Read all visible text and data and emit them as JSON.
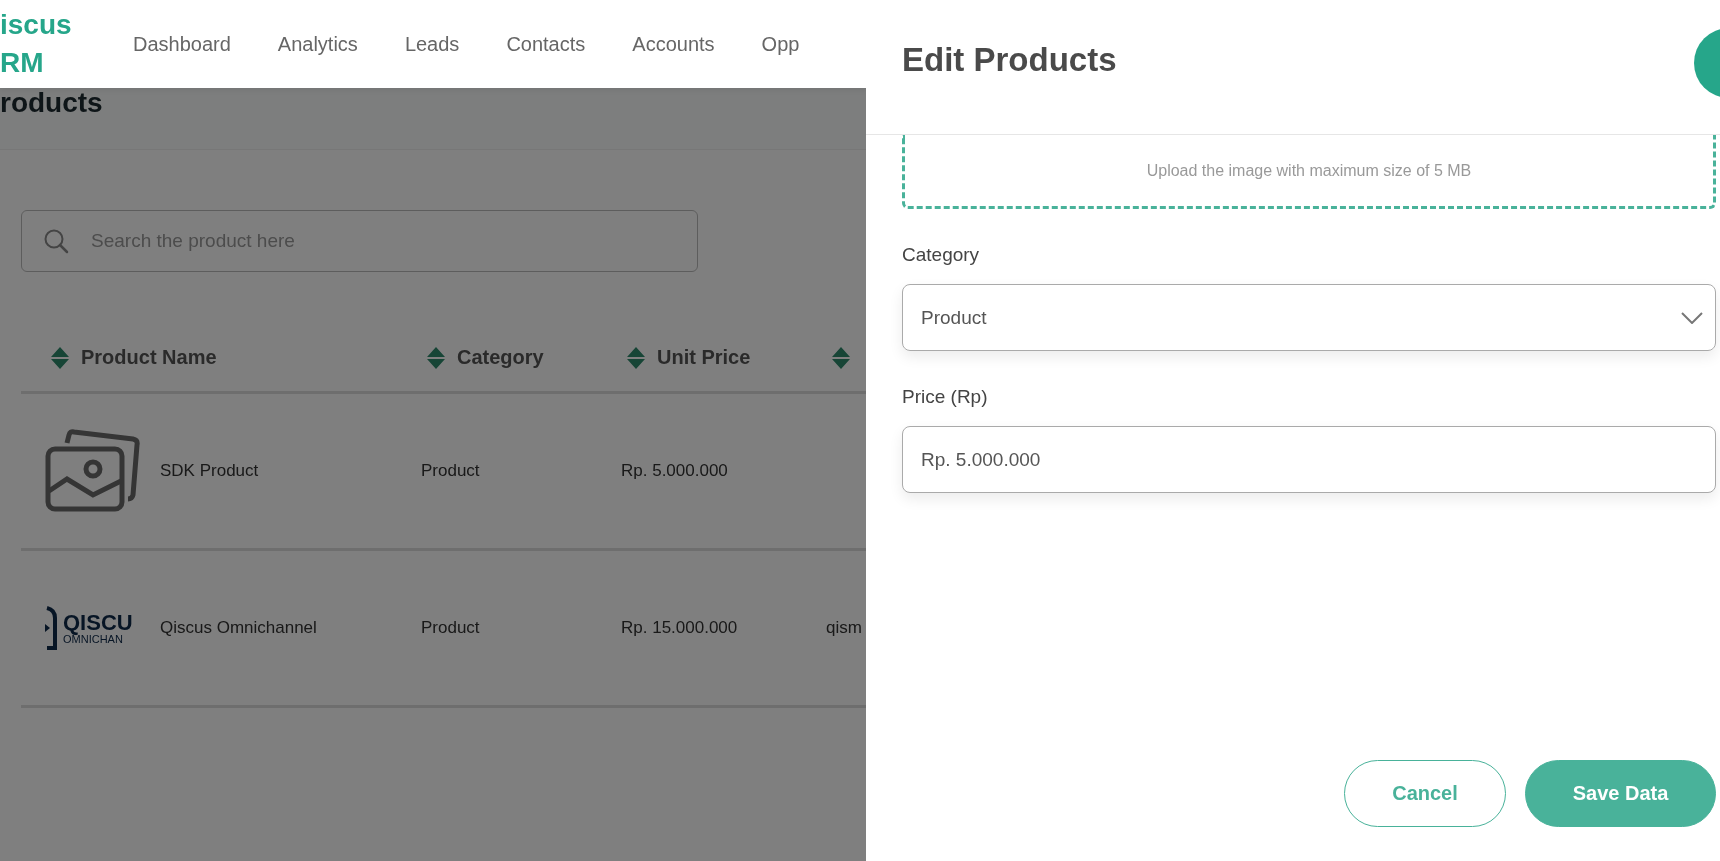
{
  "brand": {
    "lines": [
      "iscus",
      "RM"
    ]
  },
  "nav": [
    {
      "label": "Dashboard"
    },
    {
      "label": "Analytics"
    },
    {
      "label": "Leads"
    },
    {
      "label": "Contacts"
    },
    {
      "label": "Accounts"
    },
    {
      "label": "Opp"
    }
  ],
  "page_title": "roducts",
  "search": {
    "placeholder": "Search the product here"
  },
  "table": {
    "columns": [
      "Product Name",
      "Category",
      "Unit Price"
    ],
    "rows": [
      {
        "thumbnail": {
          "kind": "placeholder"
        },
        "name": "SDK Product",
        "category": "Product",
        "unit_price": "Rp. 5.000.000"
      },
      {
        "thumbnail": {
          "kind": "logo",
          "lines": [
            "QISCU",
            "OMNICHAN"
          ]
        },
        "name": "Qiscus Omnichannel",
        "category": "Product",
        "unit_price": "Rp. 15.000.000",
        "column_4": "qism"
      }
    ]
  },
  "drawer": {
    "title": "Edit Products",
    "upload_hint": "Upload the image with maximum size of 5 MB",
    "fields": [
      {
        "kind": "select",
        "label": "Category",
        "value": "Product"
      },
      {
        "kind": "input",
        "label": "Price (Rp)",
        "value": "Rp. 5.000.000"
      }
    ],
    "buttons": [
      {
        "kind": "secondary",
        "label": "Cancel"
      },
      {
        "kind": "primary",
        "label": "Save Data"
      }
    ]
  }
}
